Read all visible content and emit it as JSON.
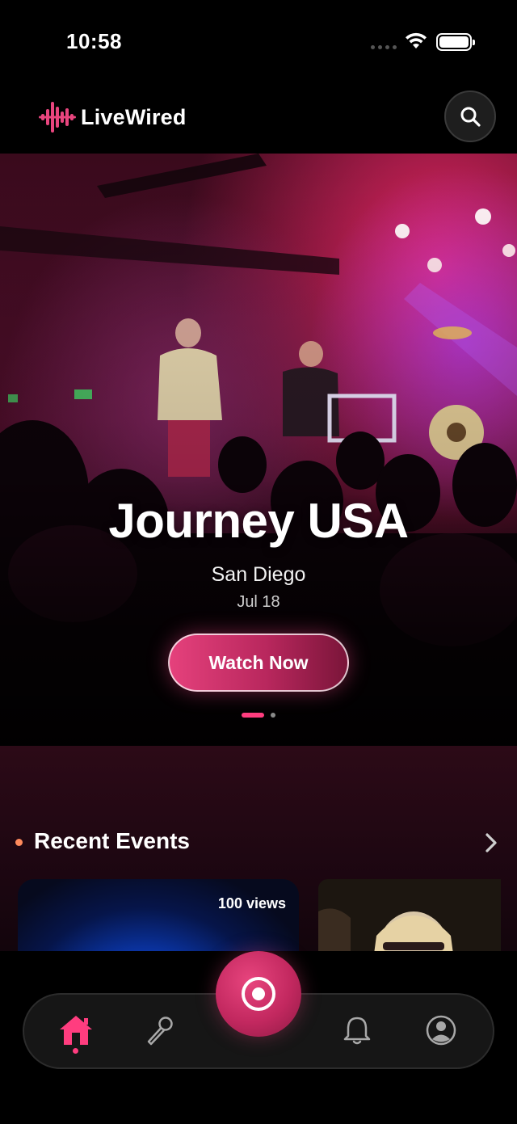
{
  "status_bar": {
    "time": "10:58"
  },
  "header": {
    "app_name": "LiveWired",
    "brand_color": "#e8457e",
    "search_icon": "search-icon"
  },
  "hero": {
    "title": "Journey USA",
    "city": "San Diego",
    "date": "Jul 18",
    "cta_label": "Watch Now",
    "slide_count": 2,
    "active_slide": 1
  },
  "recent_events": {
    "title": "Recent Events",
    "arrow_icon": "chevron-right-icon",
    "cards": [
      {
        "views": "100 views"
      },
      {
        "views": ""
      }
    ]
  },
  "bottom_nav": {
    "items": [
      {
        "icon": "home-icon",
        "active": true
      },
      {
        "icon": "microphone-icon",
        "active": false
      },
      {
        "icon": "live-record-icon",
        "active": false
      },
      {
        "icon": "bell-icon",
        "active": false
      },
      {
        "icon": "profile-icon",
        "active": false
      }
    ],
    "accent_color": "#ff3d7f"
  }
}
